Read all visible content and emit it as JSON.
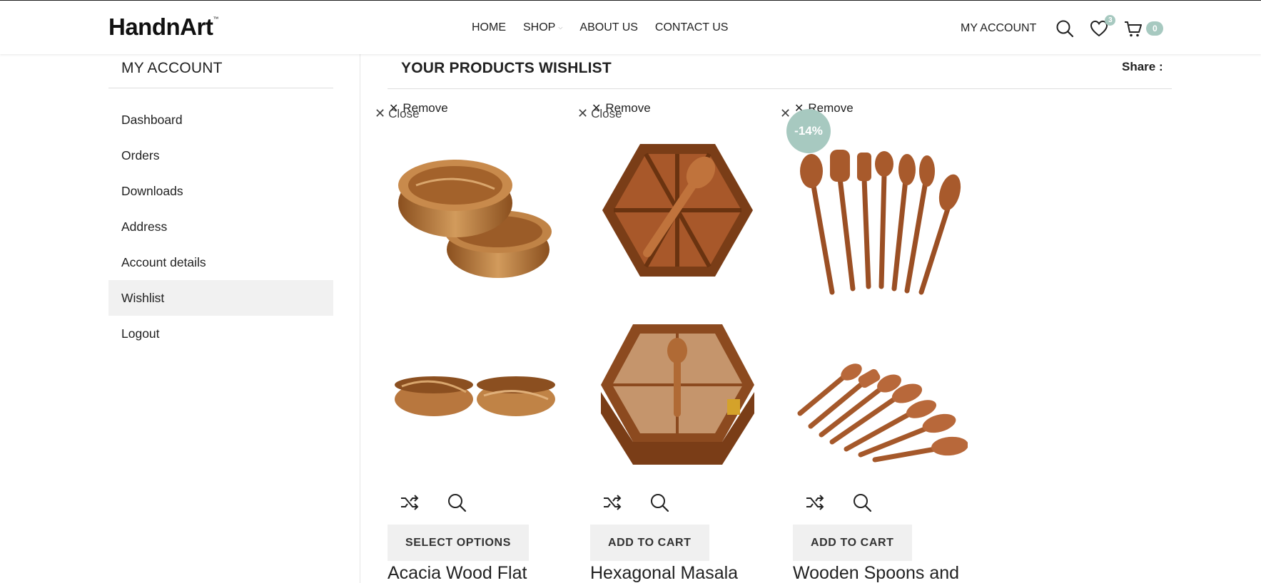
{
  "header": {
    "logo": "HandnArt",
    "logo_tm": "™",
    "nav": [
      {
        "label": "HOME"
      },
      {
        "label": "SHOP"
      },
      {
        "label": "ABOUT US"
      },
      {
        "label": "CONTACT US"
      }
    ],
    "my_account": "MY ACCOUNT",
    "wishlist_count": "3",
    "cart_count": "0"
  },
  "sidebar": {
    "title": "MY ACCOUNT",
    "items": [
      {
        "label": "Dashboard"
      },
      {
        "label": "Orders"
      },
      {
        "label": "Downloads"
      },
      {
        "label": "Address"
      },
      {
        "label": "Account details"
      },
      {
        "label": "Wishlist"
      },
      {
        "label": "Logout"
      }
    ],
    "active_item": "Wishlist"
  },
  "main": {
    "title": "YOUR PRODUCTS WISHLIST",
    "share": "Share :",
    "products": [
      {
        "remove": "Remove",
        "close": "Close",
        "discount": "",
        "button": "SELECT OPTIONS",
        "title": "Acacia Wood Flat"
      },
      {
        "remove": "Remove",
        "close": "Close",
        "discount": "",
        "button": "ADD TO CART",
        "title": "Hexagonal Masala"
      },
      {
        "remove": "Remove",
        "close": "",
        "discount": "-14%",
        "button": "ADD TO CART",
        "title": "Wooden Spoons and"
      }
    ]
  },
  "colors": {
    "accent": "#a7c9c0",
    "wood": "#b5723a",
    "button_bg": "#f0f0f0"
  }
}
